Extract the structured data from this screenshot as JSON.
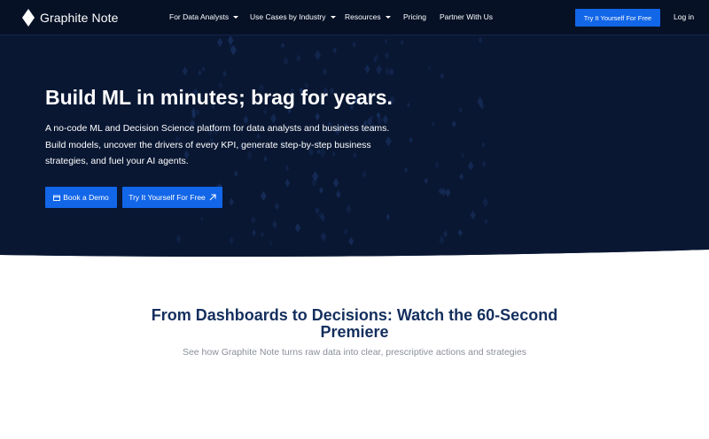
{
  "brand": {
    "name": "Graphite Note",
    "logo_icon": "diamond-logo-icon"
  },
  "nav": {
    "items": [
      {
        "label": "For Data Analysts",
        "dropdown": true
      },
      {
        "label": "Use Cases by Industry",
        "dropdown": true
      },
      {
        "label": "Resources",
        "dropdown": true
      },
      {
        "label": "Pricing",
        "dropdown": false
      },
      {
        "label": "Partner With Us",
        "dropdown": false
      }
    ],
    "cta_label": "Try It Yourself For Free",
    "login_label": "Log in"
  },
  "hero": {
    "title": "Build ML in minutes; brag for years.",
    "description_lines": [
      "A no-code ML and Decision Science platform for data analysts and business teams.",
      "Build models, uncover the drivers of every KPI, generate step-by-step business",
      "strategies, and fuel your AI agents."
    ],
    "buttons": {
      "demo_label": "Book a Demo",
      "demo_icon": "calendar-icon",
      "try_label": "Try It Yourself For Free",
      "try_icon": "arrow-up-right-icon"
    }
  },
  "video_section": {
    "title": "From Dashboards to Decisions: Watch the 60-Second Premiere",
    "subtitle": "See how Graphite Note turns raw data into clear, prescriptive actions and strategies"
  },
  "colors": {
    "hero_bg": "#091733",
    "nav_bg": "#061126",
    "accent": "#1266e8",
    "section_title": "#142f5e",
    "section_sub": "#8a8f98"
  }
}
